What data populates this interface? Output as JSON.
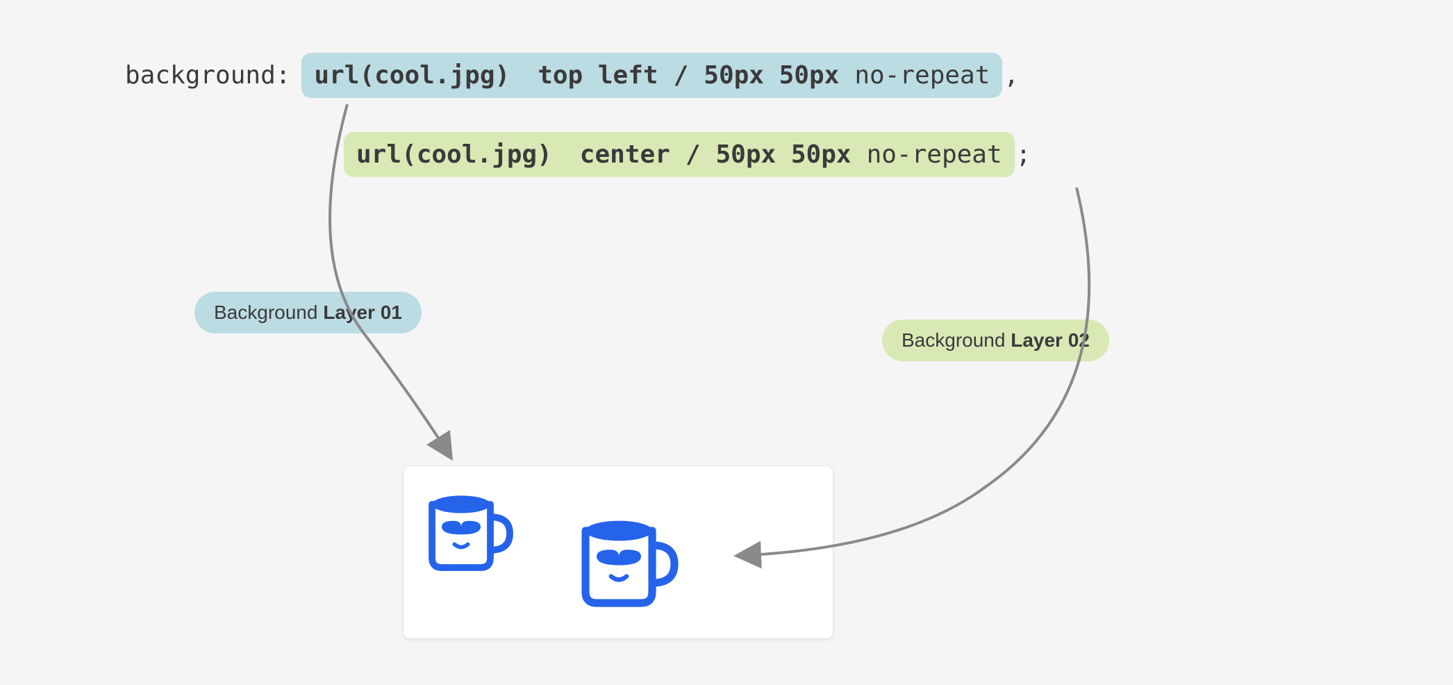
{
  "css": {
    "property": "background:",
    "layer1": {
      "url": "url(cool.jpg)",
      "position": "top left",
      "slash": "/",
      "size": "50px 50px",
      "repeat": "no-repeat",
      "trailing": ","
    },
    "layer2": {
      "url": "url(cool.jpg)",
      "position": "center",
      "slash": "/",
      "size": "50px 50px",
      "repeat": "no-repeat",
      "trailing": ";"
    }
  },
  "labels": {
    "layer1_light": "Background ",
    "layer1_strong": "Layer 01",
    "layer2_light": "Background ",
    "layer2_strong": "Layer 02"
  },
  "colors": {
    "blue": "#bcdce4",
    "green": "#d9e9b5",
    "text": "#3a3a3a",
    "mug": "#2563eb"
  }
}
